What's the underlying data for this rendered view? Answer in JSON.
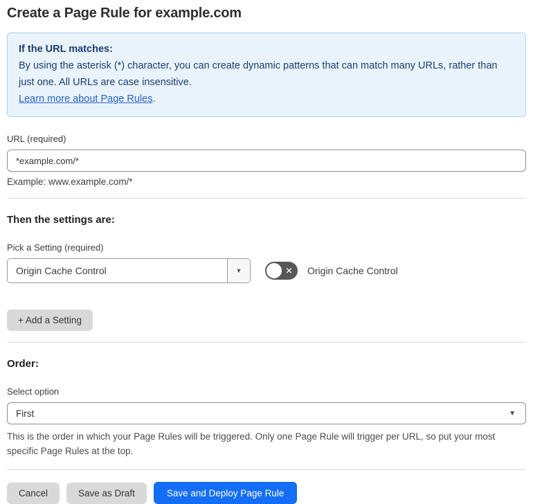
{
  "page": {
    "title": "Create a Page Rule for example.com"
  },
  "info_box": {
    "heading": "If the URL matches:",
    "body": "By using the asterisk (*) character, you can create dynamic patterns that can match many URLs, rather than just one. All URLs are case insensitive.",
    "link_label": "Learn more about Page Rules",
    "link_suffix": "."
  },
  "url_field": {
    "label": "URL (required)",
    "value": "*example.com/*",
    "hint": "Example: www.example.com/*"
  },
  "settings_section": {
    "heading": "Then the settings are:",
    "picker_label": "Pick a Setting (required)",
    "picker_value": "Origin Cache Control",
    "toggle_label": "Origin Cache Control",
    "toggle_state": "off",
    "add_setting_label": "+ Add a Setting"
  },
  "order_section": {
    "heading": "Order:",
    "select_label": "Select option",
    "select_value": "First",
    "help": "This is the order in which your Page Rules will be triggered. Only one Page Rule will trigger per URL, so put your most specific Page Rules at the top."
  },
  "actions": {
    "cancel_label": "Cancel",
    "save_draft_label": "Save as Draft",
    "save_deploy_label": "Save and Deploy Page Rule"
  },
  "icons": {
    "caret_down": "▼",
    "toggle_x": "✕"
  },
  "colors": {
    "accent_blue": "#146ef5",
    "info_bg": "#e9f3fc",
    "info_border": "#abd2f1",
    "info_text": "#1d3d6f",
    "link_blue": "#2862c6",
    "toggle_off_bg": "#575757",
    "button_gray": "#d9d9d9"
  }
}
